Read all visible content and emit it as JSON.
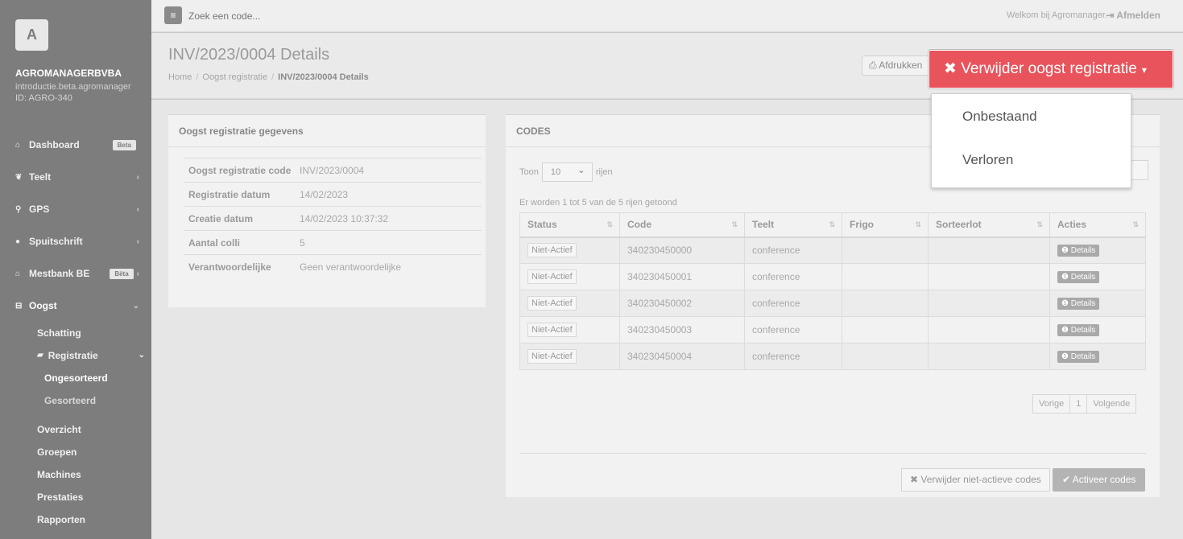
{
  "sidebar": {
    "logo_letter": "A",
    "company": "AGROMANAGERBVBA",
    "domain": "introductie.beta.agromanager",
    "id": "ID: AGRO-340",
    "items": [
      {
        "label": "Dashboard",
        "icon": "home-icon",
        "glyph": "⌂",
        "badge": "Beta"
      },
      {
        "label": "Teelt",
        "icon": "leaf-icon",
        "glyph": "❦",
        "chev": "‹"
      },
      {
        "label": "GPS",
        "icon": "map-marker-icon",
        "glyph": "⚲",
        "chev": "‹"
      },
      {
        "label": "Spuitschrift",
        "icon": "tint-icon",
        "glyph": "●",
        "chev": "‹"
      },
      {
        "label": "Mestbank BE",
        "icon": "bank-icon",
        "glyph": "⌂",
        "badge": "Bèta",
        "chev": "‹"
      },
      {
        "label": "Oogst",
        "icon": "basket-icon",
        "glyph": "⊟",
        "chev": "⌄"
      }
    ],
    "sub": {
      "schatting": "Schatting",
      "registratie": "Registratie",
      "registratie_chev": "⌄",
      "ongesorteerd": "Ongesorteerd",
      "gesorteerd": "Gesorteerd",
      "overzicht": "Overzicht",
      "groepen": "Groepen",
      "machines": "Machines",
      "prestaties": "Prestaties",
      "rapporten": "Rapporten"
    }
  },
  "topbar": {
    "menu_glyph": "≡",
    "search_placeholder": "Zoek een code...",
    "welcome": "Welkom bij Agromanager.",
    "logout": "⇥ Afmelden"
  },
  "heading": {
    "title": "INV/2023/0004 Details",
    "crumb_home": "Home",
    "crumb_oogst": "Oogst registratie",
    "crumb_current": "INV/2023/0004 Details",
    "print": "⎙ Afdrukken"
  },
  "details_panel": {
    "title": "Oogst registratie gegevens",
    "rows": [
      {
        "k": "Oogst registratie code",
        "v": "INV/2023/0004"
      },
      {
        "k": "Registratie datum",
        "v": "14/02/2023"
      },
      {
        "k": "Creatie datum",
        "v": "14/02/2023 10:37:32"
      },
      {
        "k": "Aantal colli",
        "v": "5"
      },
      {
        "k": "Verantwoordelijke",
        "v": "Geen verantwoordelijke"
      }
    ]
  },
  "codes_panel": {
    "title": "CODES",
    "show_prefix": "Toon",
    "page_size": "10",
    "show_suffix": "rijen",
    "info": "Er worden 1 tot 5 van de 5 rijen getoond",
    "columns": [
      "Status",
      "Code",
      "Teelt",
      "Frigo",
      "Sorteerlot",
      "Acties"
    ],
    "rows": [
      {
        "status": "Niet-Actief",
        "code": "340230450000",
        "teelt": "conference",
        "frigo": "",
        "sorteerlot": "",
        "action": "❶ Details"
      },
      {
        "status": "Niet-Actief",
        "code": "340230450001",
        "teelt": "conference",
        "frigo": "",
        "sorteerlot": "",
        "action": "❶ Details"
      },
      {
        "status": "Niet-Actief",
        "code": "340230450002",
        "teelt": "conference",
        "frigo": "",
        "sorteerlot": "",
        "action": "❶ Details"
      },
      {
        "status": "Niet-Actief",
        "code": "340230450003",
        "teelt": "conference",
        "frigo": "",
        "sorteerlot": "",
        "action": "❶ Details"
      },
      {
        "status": "Niet-Actief",
        "code": "340230450004",
        "teelt": "conference",
        "frigo": "",
        "sorteerlot": "",
        "action": "❶ Details"
      }
    ],
    "pager": {
      "prev": "Vorige",
      "page": "1",
      "next": "Volgende"
    },
    "remove_inactive": "✖ Verwijder niet-actieve codes",
    "activate": "✔ Activeer codes"
  },
  "delete_menu": {
    "label": "✖ Verwijder oogst registratie",
    "caret": "▾",
    "options": [
      "Onbestaand",
      "Verloren"
    ],
    "color": "#e9545c"
  }
}
